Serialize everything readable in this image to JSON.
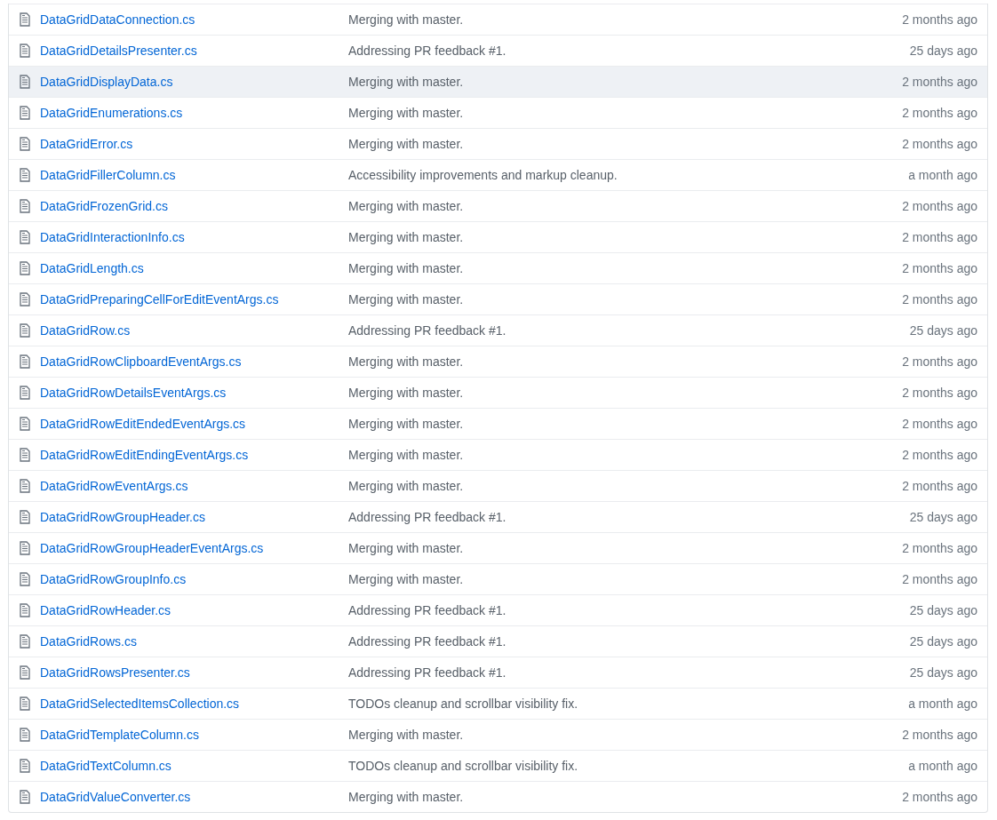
{
  "files": [
    {
      "name": "DataGridDataConnection.cs",
      "message": "Merging with master.",
      "age": "2 months ago",
      "selected": false
    },
    {
      "name": "DataGridDetailsPresenter.cs",
      "message": "Addressing PR feedback #1.",
      "age": "25 days ago",
      "selected": false
    },
    {
      "name": "DataGridDisplayData.cs",
      "message": "Merging with master.",
      "age": "2 months ago",
      "selected": true
    },
    {
      "name": "DataGridEnumerations.cs",
      "message": "Merging with master.",
      "age": "2 months ago",
      "selected": false
    },
    {
      "name": "DataGridError.cs",
      "message": "Merging with master.",
      "age": "2 months ago",
      "selected": false
    },
    {
      "name": "DataGridFillerColumn.cs",
      "message": "Accessibility improvements and markup cleanup.",
      "age": "a month ago",
      "selected": false
    },
    {
      "name": "DataGridFrozenGrid.cs",
      "message": "Merging with master.",
      "age": "2 months ago",
      "selected": false
    },
    {
      "name": "DataGridInteractionInfo.cs",
      "message": "Merging with master.",
      "age": "2 months ago",
      "selected": false
    },
    {
      "name": "DataGridLength.cs",
      "message": "Merging with master.",
      "age": "2 months ago",
      "selected": false
    },
    {
      "name": "DataGridPreparingCellForEditEventArgs.cs",
      "message": "Merging with master.",
      "age": "2 months ago",
      "selected": false
    },
    {
      "name": "DataGridRow.cs",
      "message": "Addressing PR feedback #1.",
      "age": "25 days ago",
      "selected": false
    },
    {
      "name": "DataGridRowClipboardEventArgs.cs",
      "message": "Merging with master.",
      "age": "2 months ago",
      "selected": false
    },
    {
      "name": "DataGridRowDetailsEventArgs.cs",
      "message": "Merging with master.",
      "age": "2 months ago",
      "selected": false
    },
    {
      "name": "DataGridRowEditEndedEventArgs.cs",
      "message": "Merging with master.",
      "age": "2 months ago",
      "selected": false
    },
    {
      "name": "DataGridRowEditEndingEventArgs.cs",
      "message": "Merging with master.",
      "age": "2 months ago",
      "selected": false
    },
    {
      "name": "DataGridRowEventArgs.cs",
      "message": "Merging with master.",
      "age": "2 months ago",
      "selected": false
    },
    {
      "name": "DataGridRowGroupHeader.cs",
      "message": "Addressing PR feedback #1.",
      "age": "25 days ago",
      "selected": false
    },
    {
      "name": "DataGridRowGroupHeaderEventArgs.cs",
      "message": "Merging with master.",
      "age": "2 months ago",
      "selected": false
    },
    {
      "name": "DataGridRowGroupInfo.cs",
      "message": "Merging with master.",
      "age": "2 months ago",
      "selected": false
    },
    {
      "name": "DataGridRowHeader.cs",
      "message": "Addressing PR feedback #1.",
      "age": "25 days ago",
      "selected": false
    },
    {
      "name": "DataGridRows.cs",
      "message": "Addressing PR feedback #1.",
      "age": "25 days ago",
      "selected": false
    },
    {
      "name": "DataGridRowsPresenter.cs",
      "message": "Addressing PR feedback #1.",
      "age": "25 days ago",
      "selected": false
    },
    {
      "name": "DataGridSelectedItemsCollection.cs",
      "message": "TODOs cleanup and scrollbar visibility fix.",
      "age": "a month ago",
      "selected": false
    },
    {
      "name": "DataGridTemplateColumn.cs",
      "message": "Merging with master.",
      "age": "2 months ago",
      "selected": false
    },
    {
      "name": "DataGridTextColumn.cs",
      "message": "TODOs cleanup and scrollbar visibility fix.",
      "age": "a month ago",
      "selected": false
    },
    {
      "name": "DataGridValueConverter.cs",
      "message": "Merging with master.",
      "age": "2 months ago",
      "selected": false
    }
  ]
}
